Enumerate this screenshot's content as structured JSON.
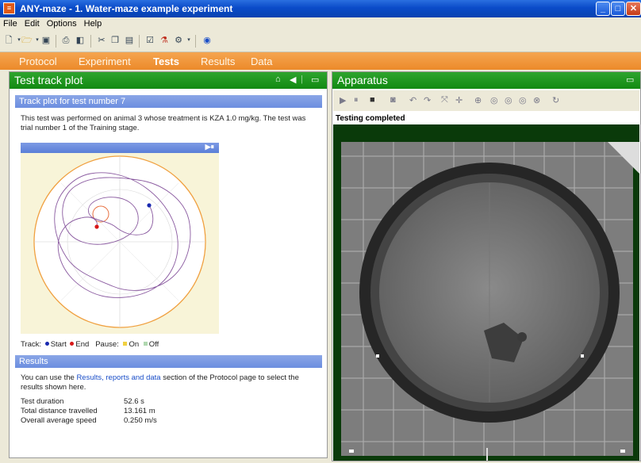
{
  "window": {
    "title": "ANY-maze - 1. Water-maze example experiment",
    "app_icon": "anymaze-icon"
  },
  "menu": [
    "File",
    "Edit",
    "Options",
    "Help"
  ],
  "tabs": [
    "Protocol",
    "Experiment",
    "Tests",
    "Results",
    "Data"
  ],
  "active_tab": "Tests",
  "left_panel": {
    "title": "Test track plot",
    "section_title": "Track plot for test number 7",
    "description": "This test was performed on animal 3 whose treatment is KZA 1.0 mg/kg.  The test was trial number 1 of the Training stage.",
    "legend": {
      "track_label": "Track:",
      "start": "Start",
      "end": "End",
      "pause_label": "Pause:",
      "on": "On",
      "off": "Off"
    },
    "results_title": "Results",
    "results_text_before": "You can use the ",
    "results_link": "Results, reports and data",
    "results_text_after": " section of the Protocol page to select the results shown here.",
    "results": [
      {
        "label": "Test duration",
        "value": "52.6 s"
      },
      {
        "label": "Total distance travelled",
        "value": "13.161 m"
      },
      {
        "label": "Overall average speed",
        "value": "0.250 m/s"
      }
    ]
  },
  "right_panel": {
    "title": "Apparatus",
    "status": "Testing completed"
  },
  "colors": {
    "title_blue": "#0a4bc8",
    "tab_orange": "#ec8a2a",
    "panel_green": "#128a12",
    "section_blue": "#6c8ee0",
    "track_purple": "#8a5aa0",
    "start_blue": "#1a2ab0",
    "end_red": "#d81818",
    "pause_on": "#f0d040",
    "pause_off": "#b0d8b0"
  }
}
